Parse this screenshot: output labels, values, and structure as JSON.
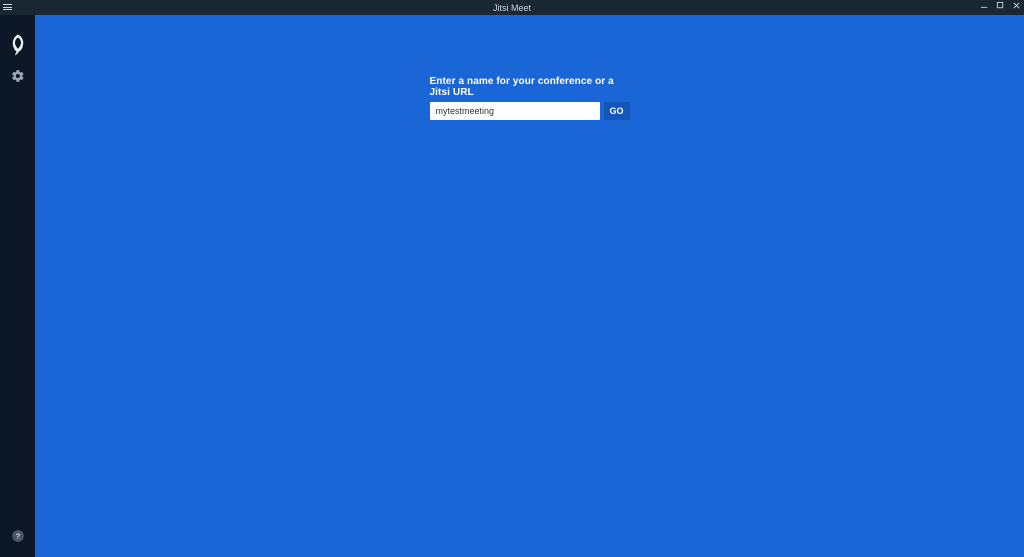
{
  "window": {
    "title": "Jitsi Meet"
  },
  "sidebar": {
    "logo_name": "jitsi-logo",
    "settings_name": "settings",
    "help_name": "help"
  },
  "main": {
    "prompt_label": "Enter a name for your conference or a Jitsi URL",
    "input_value": "mytestmeeting",
    "go_label": "GO"
  }
}
